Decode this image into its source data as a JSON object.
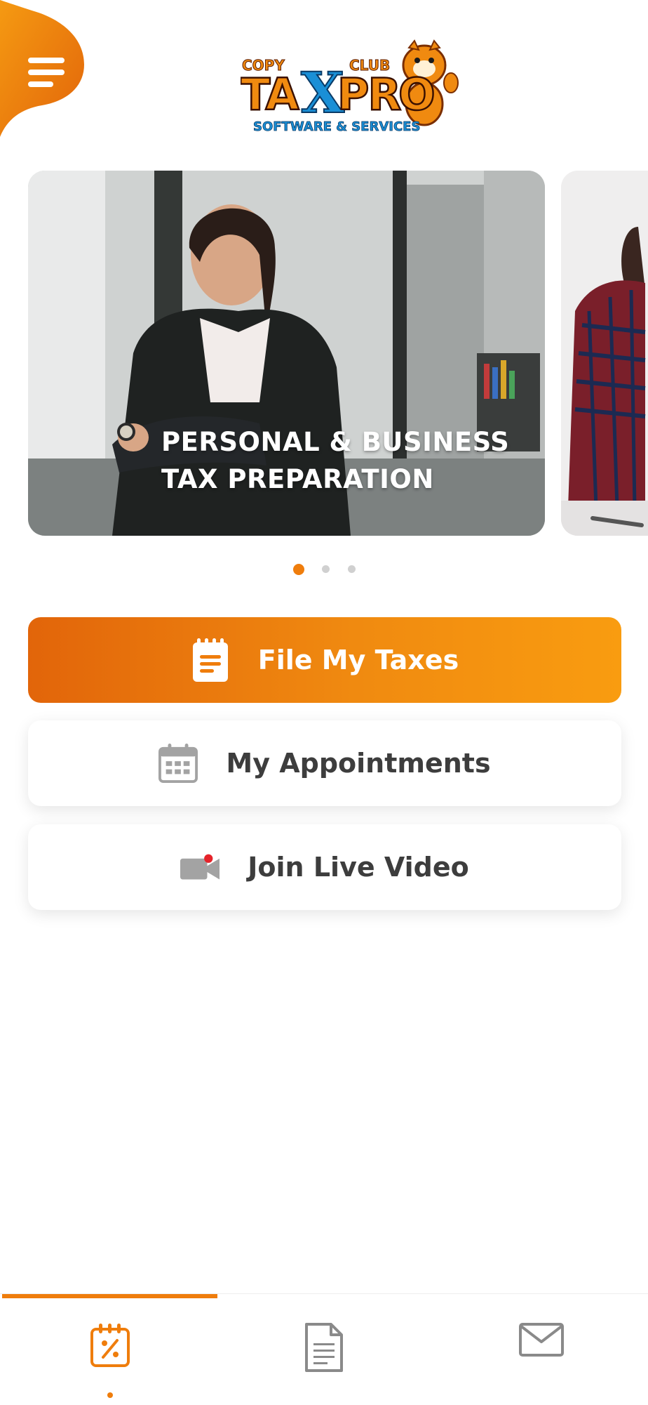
{
  "header": {
    "menu_icon": "hamburger-menu-icon",
    "logo": {
      "top_left_text": "COPY",
      "top_right_text": "CLUB",
      "main_text": "TAXPRO",
      "sub_text": "SOFTWARE & SERVICES"
    }
  },
  "carousel": {
    "slides": [
      {
        "caption_line1": "PERSONAL & BUSINESS",
        "caption_line2": "TAX PREPARATION"
      },
      {
        "caption_line1": "",
        "caption_line2": ""
      }
    ],
    "dots_count": 3,
    "active_dot_index": 0
  },
  "actions": [
    {
      "label": "File My Taxes",
      "icon": "clipboard-icon"
    },
    {
      "label": "My Appointments",
      "icon": "calendar-icon"
    },
    {
      "label": "Join Live Video",
      "icon": "video-camera-icon"
    }
  ],
  "bottom_nav": {
    "items": [
      {
        "icon": "tax-calendar-icon",
        "active": true
      },
      {
        "icon": "document-icon",
        "active": false
      },
      {
        "icon": "mail-icon",
        "active": false
      }
    ]
  },
  "colors": {
    "accent": "#ef7d0c",
    "accent_dark": "#e2650a",
    "accent_light": "#f99c10",
    "text_dark": "#3d3d3d",
    "icon_gray": "#9a9a9a",
    "logo_blue": "#1a8fd6"
  }
}
